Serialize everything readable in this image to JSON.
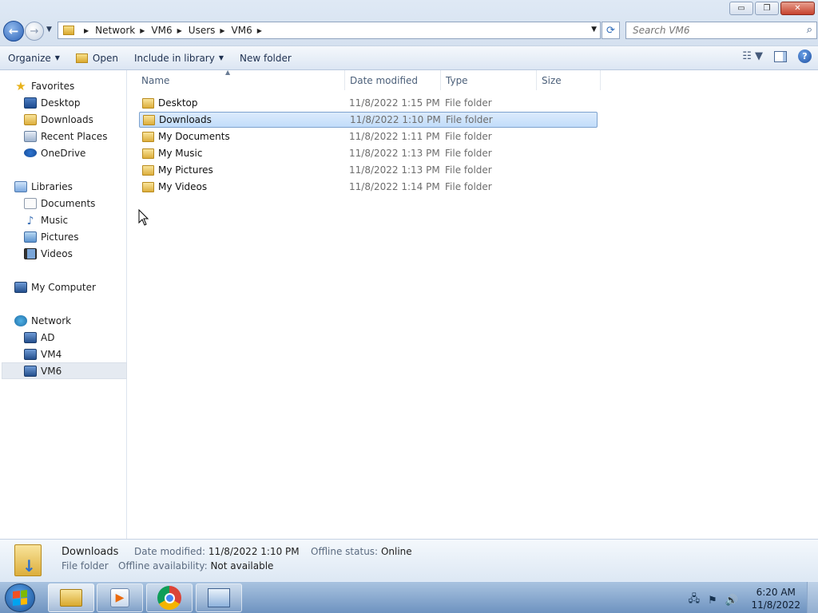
{
  "window": {
    "minimize": "▭",
    "maximize": "❐",
    "close": "✕"
  },
  "address": {
    "crumbs": [
      "Network",
      "VM6",
      "Users",
      "VM6"
    ]
  },
  "search": {
    "placeholder": "Search VM6"
  },
  "toolbar": {
    "organize": "Organize",
    "open": "Open",
    "include": "Include in library",
    "new_folder": "New folder"
  },
  "nav": {
    "favorites": "Favorites",
    "desktop": "Desktop",
    "downloads": "Downloads",
    "recent": "Recent Places",
    "onedrive": "OneDrive",
    "libraries": "Libraries",
    "documents": "Documents",
    "music": "Music",
    "pictures": "Pictures",
    "videos": "Videos",
    "computer": "My Computer",
    "network": "Network",
    "ad": "AD",
    "vm4": "VM4",
    "vm6": "VM6"
  },
  "columns": {
    "name": "Name",
    "date": "Date modified",
    "type": "Type",
    "size": "Size"
  },
  "files": [
    {
      "name": "Desktop",
      "date": "11/8/2022 1:15 PM",
      "type": "File folder"
    },
    {
      "name": "Downloads",
      "date": "11/8/2022 1:10 PM",
      "type": "File folder"
    },
    {
      "name": "My Documents",
      "date": "11/8/2022 1:11 PM",
      "type": "File folder"
    },
    {
      "name": "My Music",
      "date": "11/8/2022 1:13 PM",
      "type": "File folder"
    },
    {
      "name": "My Pictures",
      "date": "11/8/2022 1:13 PM",
      "type": "File folder"
    },
    {
      "name": "My Videos",
      "date": "11/8/2022 1:14 PM",
      "type": "File folder"
    }
  ],
  "details": {
    "name": "Downloads",
    "kind": "File folder",
    "date_label": "Date modified:",
    "date_value": "11/8/2022 1:10 PM",
    "offline_avail_label": "Offline availability:",
    "offline_avail_value": "Not available",
    "offline_status_label": "Offline status:",
    "offline_status_value": "Online"
  },
  "clock": {
    "time": "6:20 AM",
    "date": "11/8/2022"
  }
}
